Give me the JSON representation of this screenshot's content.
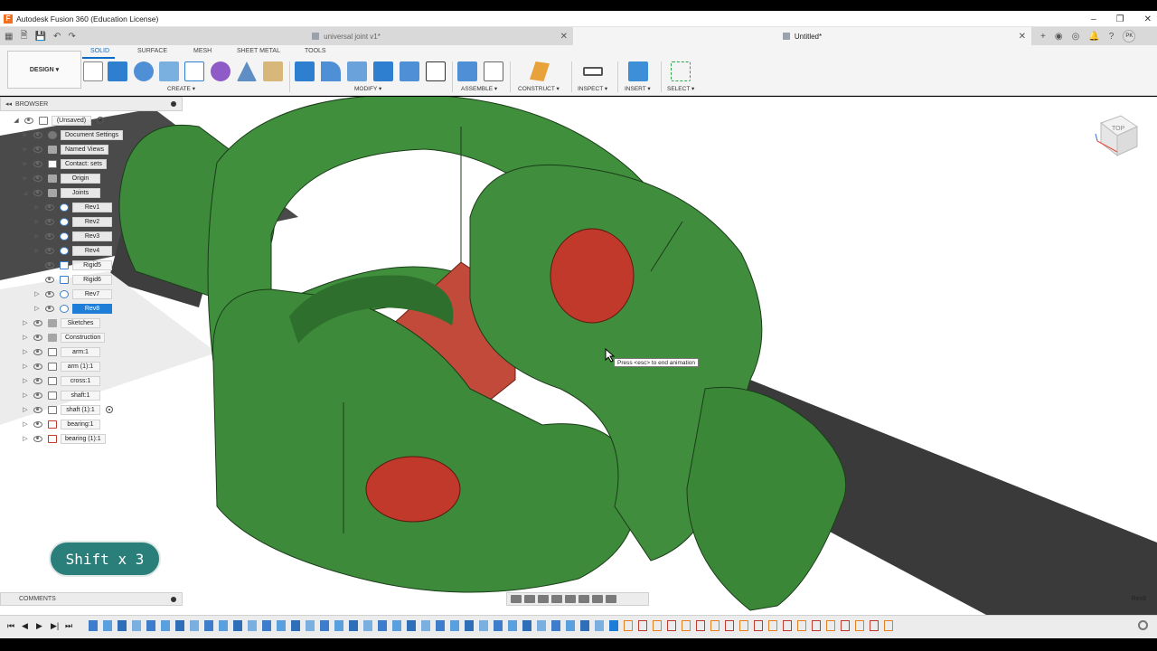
{
  "window": {
    "title": "Autodesk Fusion 360 (Education License)",
    "controls": [
      "–",
      "❐",
      "✕"
    ]
  },
  "tabs": [
    {
      "label": "universal joint v1*",
      "active": false
    },
    {
      "label": "Untitled*",
      "active": true
    }
  ],
  "toolbar": {
    "workspace": "DESIGN ▾",
    "tabs": [
      "SOLID",
      "SURFACE",
      "MESH",
      "SHEET METAL",
      "TOOLS"
    ],
    "active_tab": "SOLID",
    "groups": [
      "CREATE ▾",
      "MODIFY ▾",
      "ASSEMBLE ▾",
      "CONSTRUCT ▾",
      "INSPECT ▾",
      "INSERT ▾",
      "SELECT ▾"
    ]
  },
  "browser": {
    "title": "BROWSER",
    "items": [
      {
        "label": "(Unsaved)",
        "icon": "component-icon"
      },
      {
        "label": "Document Settings",
        "icon": "gear-icon"
      },
      {
        "label": "Named Views",
        "icon": "folder-icon"
      },
      {
        "label": "Contact: sets",
        "icon": "contact-icon"
      },
      {
        "label": "Origin",
        "icon": "folder-icon"
      },
      {
        "label": "Joints",
        "icon": "folder-icon"
      },
      {
        "label": "Rev1",
        "icon": "revolute-joint-icon"
      },
      {
        "label": "Rev2",
        "icon": "revolute-joint-icon"
      },
      {
        "label": "Rev3",
        "icon": "revolute-joint-icon"
      },
      {
        "label": "Rev4",
        "icon": "revolute-joint-icon"
      },
      {
        "label": "Rigid5",
        "icon": "rigid-joint-icon"
      },
      {
        "label": "Rigid6",
        "icon": "rigid-joint-icon"
      },
      {
        "label": "Rev7",
        "icon": "revolute-joint-icon"
      },
      {
        "label": "Rev8",
        "icon": "revolute-joint-icon",
        "selected": true
      },
      {
        "label": "Sketches",
        "icon": "folder-icon"
      },
      {
        "label": "Construction",
        "icon": "folder-icon"
      },
      {
        "label": "arm:1",
        "icon": "component-icon"
      },
      {
        "label": "arm (1):1",
        "icon": "component-icon"
      },
      {
        "label": "cross:1",
        "icon": "component-icon"
      },
      {
        "label": "shaft:1",
        "icon": "component-icon"
      },
      {
        "label": "shaft (1):1",
        "icon": "component-icon"
      },
      {
        "label": "bearing:1",
        "icon": "bearing-icon"
      },
      {
        "label": "bearing (1):1",
        "icon": "bearing-icon"
      }
    ]
  },
  "viewport": {
    "tooltip": "Press <esc> to end animation",
    "viewcube_face": "TOP",
    "keystroke_overlay": "Shift x 3",
    "colors": {
      "arm": "#3c8a3a",
      "cross": "#c0392b",
      "shaft": "#3a3a3a"
    }
  },
  "comments": {
    "title": "COMMENTS"
  },
  "status": {
    "selection": "Rev8"
  },
  "timeline": {
    "controls": [
      "⏮",
      "◀",
      "▶",
      "▶|",
      "⏭"
    ]
  }
}
